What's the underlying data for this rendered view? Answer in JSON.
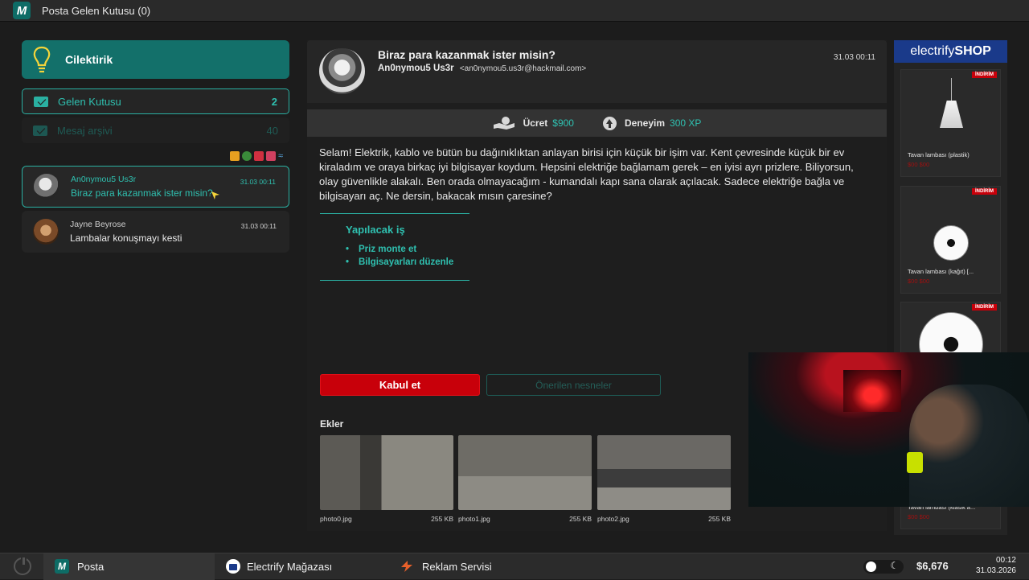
{
  "window": {
    "title": "Posta Gelen Kutusu (0)",
    "logo_letter": "M"
  },
  "sidebar": {
    "brand": "Cilektirik",
    "folders": [
      {
        "label": "Gelen Kutusu",
        "count": "2"
      },
      {
        "label": "Mesaj arşivi",
        "count": "40"
      }
    ],
    "messages": [
      {
        "sender": "An0nymou5 Us3r",
        "subject": "Biraz para kazanmak ister misin?",
        "time": "31.03 00:11"
      },
      {
        "sender": "Jayne Beyrose",
        "subject": "Lambalar konuşmayı kesti",
        "time": "31.03 00:11"
      }
    ]
  },
  "mail": {
    "subject": "Biraz para kazanmak ister misin?",
    "from_name": "An0nymou5 Us3r",
    "from_email": "<an0nymou5.us3r@hackmail.com>",
    "time": "31.03 00:11",
    "fee_label": "Ücret",
    "fee_value": "$900",
    "xp_label": "Deneyim",
    "xp_value": "300 XP",
    "body": "Selam! Elektrik, kablo ve bütün bu dağınıklıktan anlayan birisi için küçük bir işim var. Kent çevresinde küçük bir ev kiraladım ve oraya birkaç iyi bilgisayar koydum. Hepsini elektriğe bağlamam gerek – en iyisi ayrı prizlere. Biliyorsun, olay güvenlikle alakalı. Ben orada olmayacağım - kumandalı kapı sana olarak açılacak. Sadece elektriğe bağla ve bilgisayarı aç. Ne dersin, bakacak mısın çaresine?",
    "todo_title": "Yapılacak iş",
    "todo_items": [
      "Priz monte et",
      "Bilgisayarları düzenle"
    ],
    "accept_label": "Kabul et",
    "suggest_label": "Önerilen nesneler",
    "attachments_label": "Ekler",
    "attachments": [
      {
        "name": "photo0.jpg",
        "size": "255 KB"
      },
      {
        "name": "photo1.jpg",
        "size": "255 KB"
      },
      {
        "name": "photo2.jpg",
        "size": "255 KB"
      }
    ]
  },
  "shop": {
    "brand_light": "electrify",
    "brand_bold": "SHOP",
    "badge": "İNDİRİM",
    "products": [
      {
        "name": "Tavan lambası (plastik)",
        "price": "$00 $00"
      },
      {
        "name": "Tavan lambası (kağıt) [...",
        "price": "$00 $00"
      },
      {
        "name": "Tavan lambası (klasik a...",
        "price": "$00 $00"
      }
    ]
  },
  "taskbar": {
    "apps": [
      "Posta",
      "Electrify Mağazası",
      "Reklam Servisi"
    ],
    "money": "$6,676",
    "time": "00:12",
    "date": "31.03.2026"
  },
  "colors": {
    "accent": "#2fc0b0",
    "brand": "#13706a",
    "danger": "#c8000a",
    "shop": "#1a3a8a"
  }
}
